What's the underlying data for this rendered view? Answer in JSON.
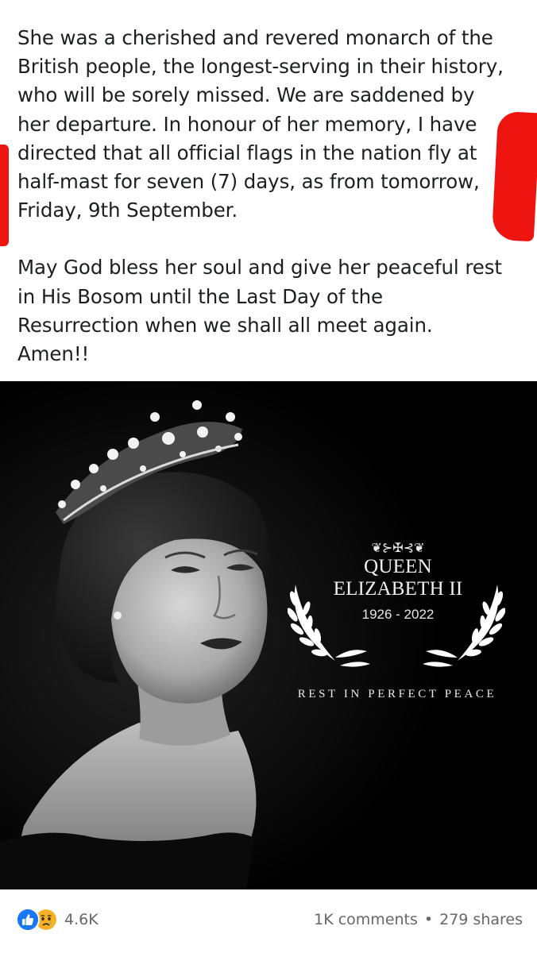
{
  "post": {
    "paragraph1": [
      "She was a cherished and revered monarch of the",
      "British people, the longest-serving in their history,",
      "who will be sorely missed. We are saddened by",
      "her departure. In honour of her memory, I have",
      "directed that all official flags in the nation fly at",
      "half-mast for seven (7) days, as from tomorrow,",
      "Friday, 9th September."
    ],
    "paragraph2": [
      "May God bless her soul and give her peaceful rest",
      "in His Bosom until the Last Day of the",
      "Resurrection when we shall all meet again.",
      "Amen!!"
    ]
  },
  "image": {
    "ornament": "❦⊱✠⊰❦",
    "name_line1": "QUEEN",
    "name_line2": "ELIZABETH II",
    "years": "1926 - 2022",
    "subtitle": "REST IN PERFECT PEACE"
  },
  "footer": {
    "reaction_icons": [
      "like-icon",
      "sad-icon"
    ],
    "reaction_count": "4.6K",
    "comments": "1K comments",
    "separator": "•",
    "shares": "279 shares"
  },
  "colors": {
    "like": "#1877f2",
    "sad": "#f7b125",
    "annotation": "#ee1410",
    "meta_text": "#65676b"
  }
}
